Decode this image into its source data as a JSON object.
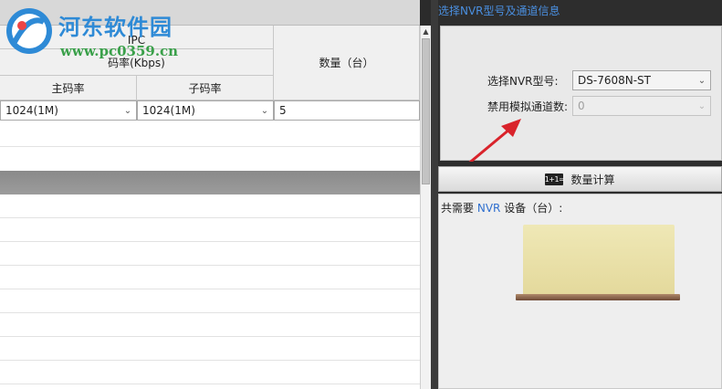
{
  "watermark": {
    "site_name": "河东软件园",
    "url": "www.pc0359.cn"
  },
  "table": {
    "group_header": "IPC",
    "bitrate_header": "码率(Kbps)",
    "main_stream_header": "主码率",
    "sub_stream_header": "子码率",
    "quantity_header": "数量（台）",
    "row": {
      "main_stream": "1024(1M)",
      "sub_stream": "1024(1M)",
      "quantity": "5"
    }
  },
  "right_panel": {
    "title": "选择NVR型号及通道信息",
    "nvr_model_label": "选择NVR型号:",
    "nvr_model_value": "DS-7608N-ST",
    "disable_analog_label": "禁用模拟通道数:",
    "disable_analog_value": "0",
    "calc_button_label": "数量计算",
    "calc_icon_text": "1+1=",
    "result": {
      "prefix": "共需要",
      "nvr": "NVR",
      "suffix": "设备（台）:"
    }
  },
  "colors": {
    "accent": "#4a8fe0",
    "arrow": "#d9232b",
    "device": "#e8dfa8"
  },
  "icons": {
    "scroll_up": "triangle-up",
    "dropdown": "chevron-down",
    "calc": "calculator-icon"
  }
}
